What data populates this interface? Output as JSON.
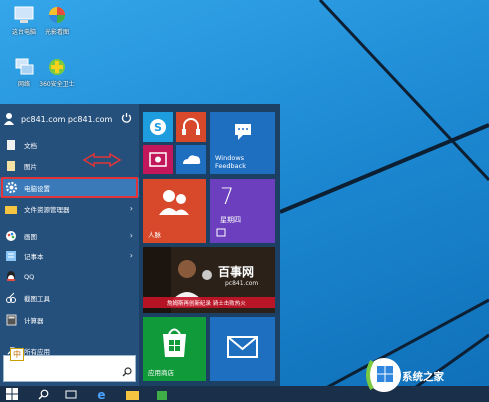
{
  "desktop": {
    "icons": [
      {
        "label": "这台电脑",
        "icon": "computer-icon"
      },
      {
        "label": "光影看图",
        "icon": "photo-viewer-icon"
      },
      {
        "label": "网络",
        "icon": "network-icon"
      },
      {
        "label": "360安全卫士",
        "icon": "360-security-icon"
      }
    ]
  },
  "start_menu": {
    "user_name": "pc841.com pc841.com",
    "power_icon": "power-icon",
    "items": [
      {
        "label": "文档",
        "icon": "document-icon",
        "has_arrow": false
      },
      {
        "label": "图片",
        "icon": "pictures-icon",
        "has_arrow": false
      },
      {
        "label": "电脑设置",
        "icon": "gear-icon",
        "has_arrow": false
      },
      {
        "label": "文件资源管理器",
        "icon": "folder-icon",
        "has_arrow": true
      },
      {
        "label": "画图",
        "icon": "paint-icon",
        "has_arrow": true
      },
      {
        "label": "记事本",
        "icon": "notepad-icon",
        "has_arrow": true
      },
      {
        "label": "QQ",
        "icon": "qq-icon",
        "has_arrow": false
      },
      {
        "label": "截图工具",
        "icon": "snipping-icon",
        "has_arrow": false
      },
      {
        "label": "计算器",
        "icon": "calculator-icon",
        "has_arrow": false
      },
      {
        "label": "所有应用",
        "icon": "all-apps-icon",
        "has_arrow": false
      }
    ],
    "search": {
      "value": "",
      "placeholder": ""
    },
    "ime_label": "中"
  },
  "tiles": {
    "skype": {
      "icon": "skype-icon"
    },
    "music": {
      "icon": "headphones-icon"
    },
    "feedback": {
      "label": "Windows Feedback",
      "icon": "feedback-icon"
    },
    "video": {
      "icon": "video-icon"
    },
    "onedrive": {
      "icon": "onedrive-icon"
    },
    "people": {
      "label": "人脉",
      "icon": "people-icon"
    },
    "calendar": {
      "day": "7",
      "weekday": "星期四"
    },
    "news": {
      "brand": "百事网",
      "domain": "pc841.com",
      "headline": "詹姆斯再创新纪录 骑士击败热火"
    },
    "store": {
      "label": "应用商店",
      "icon": "store-icon"
    },
    "mail": {
      "icon": "mail-icon"
    }
  },
  "taskbar": {
    "items": [
      "start-button",
      "search-icon",
      "task-view-icon",
      "ie-icon",
      "explorer-icon",
      "store-icon"
    ]
  },
  "watermark": {
    "text": "系统之家"
  },
  "colors": {
    "desktop": "#1f8ad0",
    "start_left": "#26507c",
    "start_right": "#1c3f64",
    "highlight": "#e0343a",
    "tile_skype": "#1d9cde",
    "tile_orange": "#d8482a",
    "tile_purple": "#6b3fbd",
    "tile_green": "#109a3a",
    "tile_blue": "#1f6fc0"
  }
}
